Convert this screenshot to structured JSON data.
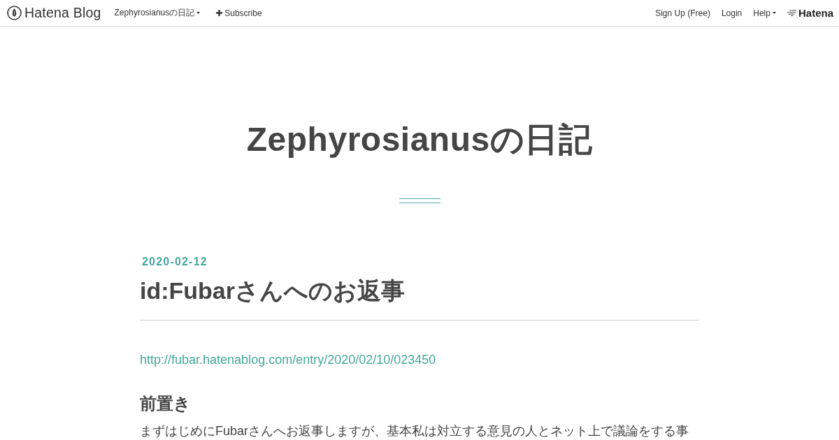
{
  "header": {
    "logo": "Hatena Blog",
    "blog_menu": "Zephyrosianusの日記",
    "subscribe": "Subscribe",
    "links": [
      "Sign Up (Free)",
      "Login"
    ],
    "help": "Help",
    "brand": "Hatena"
  },
  "blog_title": "Zephyrosianusの日記",
  "entry": {
    "date": "2020-02-12",
    "title": "id:Fubarさんへのお返事",
    "link": "http://fubar.hatenablog.com/entry/2020/02/10/023450",
    "heading": "前置き",
    "paragraph": "まずはじめにFubarさんへお返事しますが、基本私は対立する意見の人とネット上で議論をする事"
  }
}
